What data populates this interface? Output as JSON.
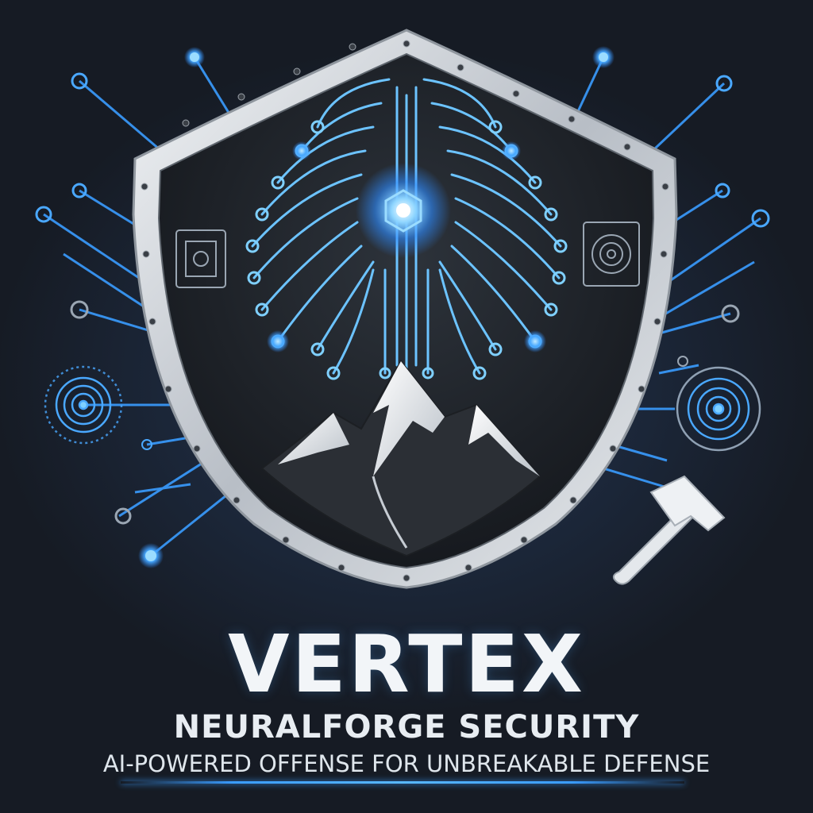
{
  "brand": {
    "title": "VERTEX",
    "subtitle": "NEURALFORGE SECURITY",
    "tagline": "AI-POWERED OFFENSE FOR UNBREAKABLE DEFENSE"
  },
  "colors": {
    "background": "#1b2029",
    "accent_blue": "#3a9cff",
    "glow_blue": "#7fd0ff",
    "shield_rim": "#d9dde2",
    "shield_face": "#22272e",
    "text": "#f2f5f8"
  },
  "icons": [
    "shield-icon",
    "brain-circuit-icon",
    "mountain-icon",
    "hammer-icon",
    "microchip-icon",
    "fingerprint-icon"
  ]
}
